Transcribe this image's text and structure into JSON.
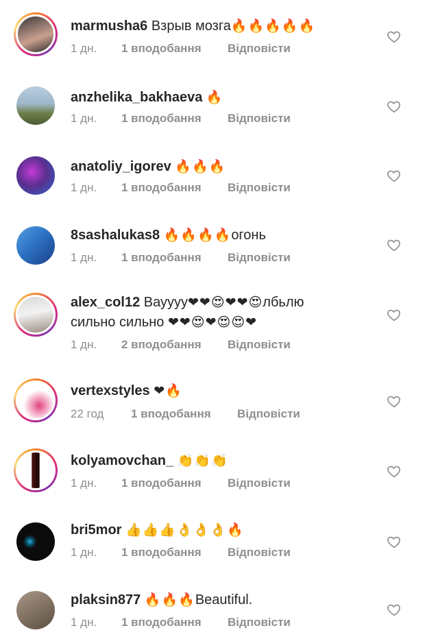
{
  "comments": [
    {
      "username": "marmusha6",
      "text": " Взрыв мозга",
      "emoji": "🔥🔥🔥🔥🔥",
      "text2": "",
      "emoji2": "",
      "time": "1 дн.",
      "likes": "1 вподобання",
      "reply": "Відповісти",
      "avatar_colors": [
        "#2b2b2b",
        "#c89b8c"
      ],
      "ring": true
    },
    {
      "username": "anzhelika_bakhaeva",
      "text": " ",
      "emoji": "🔥",
      "text2": "",
      "emoji2": "",
      "time": "1 дн.",
      "likes": "1 вподобання",
      "reply": "Відповісти",
      "avatar_colors": [
        "#9fb7c9",
        "#6d7f4a"
      ],
      "ring": false
    },
    {
      "username": "anatoliy_igorev",
      "text": " ",
      "emoji": "🔥🔥🔥",
      "text2": "",
      "emoji2": "",
      "time": "1 дн.",
      "likes": "1 вподобання",
      "reply": "Відповісти",
      "avatar_colors": [
        "#5a2f8e",
        "#2d63c7"
      ],
      "ring": false
    },
    {
      "username": "8sashalukas8",
      "text": " ",
      "emoji": "🔥🔥🔥🔥",
      "text2": "огонь",
      "emoji2": "",
      "time": "1 дн.",
      "likes": "1 вподобання",
      "reply": "Відповісти",
      "avatar_colors": [
        "#2f77c9",
        "#1c3f8a"
      ],
      "ring": false
    },
    {
      "username": "alex_col12",
      "text": " Вауууу",
      "emoji": "❤❤😍❤❤😍",
      "text2": "лбьлю",
      "emoji2": "",
      "line2_text": "сильно сильно ",
      "line2_emoji": "❤❤😍❤😍😍❤",
      "time": "1 дн.",
      "likes": "2 вподобання",
      "reply": "Відповісти",
      "avatar_colors": [
        "#e8e8e8",
        "#9a8a80"
      ],
      "ring": true
    },
    {
      "username": "vertexstyles",
      "text": " ",
      "emoji": "❤🔥",
      "text2": "",
      "emoji2": "",
      "time": "22 год",
      "likes": "1 вподобання",
      "reply": "Відповісти",
      "avatar_colors": [
        "#ffffff",
        "#e0457e"
      ],
      "ring": true
    },
    {
      "username": "kolyamovchan_",
      "text": " ",
      "emoji": "👏👏👏",
      "text2": "",
      "emoji2": "",
      "time": "1 дн.",
      "likes": "1 вподобання",
      "reply": "Відповісти",
      "avatar_colors": [
        "#ffffff",
        "#4a1010"
      ],
      "ring": true
    },
    {
      "username": "bri5mor",
      "text": " ",
      "emoji": "👍👍👍👌👌👌🔥",
      "text2": "",
      "emoji2": "",
      "time": "1 дн.",
      "likes": "1 вподобання",
      "reply": "Відповісти",
      "avatar_colors": [
        "#0b0b0b",
        "#2ab3e0"
      ],
      "ring": false
    },
    {
      "username": "plaksin877",
      "text": " ",
      "emoji": "🔥🔥🔥",
      "text2": "Beautiful.",
      "emoji2": "",
      "time": "1 дн.",
      "likes": "1 вподобання",
      "reply": "Відповісти",
      "avatar_colors": [
        "#7a6b5c",
        "#a89888"
      ],
      "ring": false
    }
  ],
  "colors": {
    "text": "#262626",
    "meta": "#8e8e8e",
    "flame": "#ff8c00",
    "heart_red": "#e0245e"
  },
  "icons": {
    "like": "heart-outline-icon"
  }
}
